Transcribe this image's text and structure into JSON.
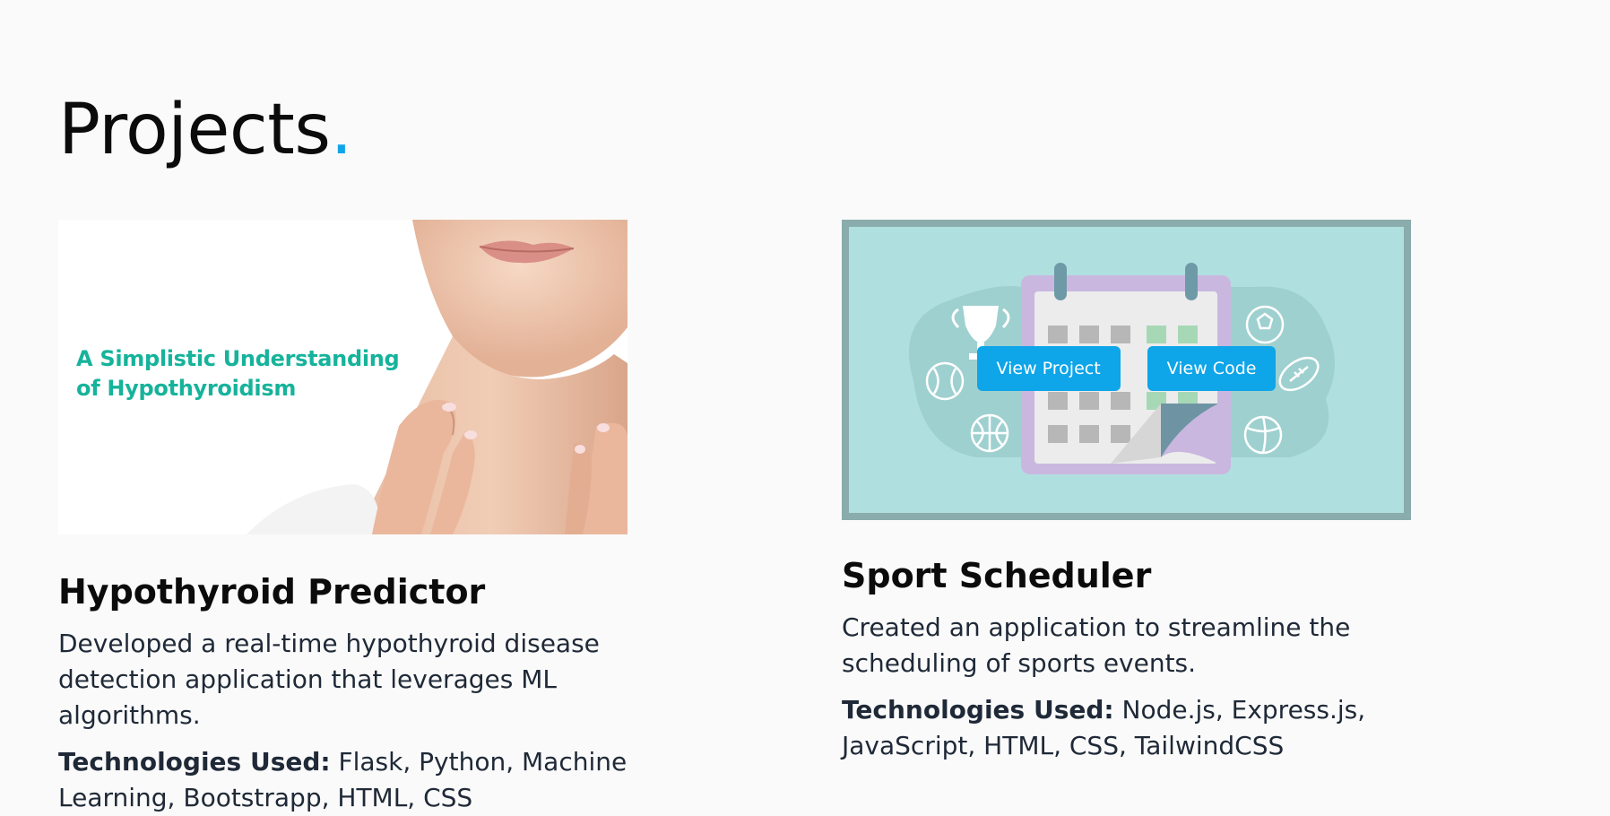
{
  "section": {
    "title": "Projects",
    "title_dot": "."
  },
  "projects": [
    {
      "image_caption_line1": "A Simplistic Understanding",
      "image_caption_line2": "of Hypothyroidism",
      "title": "Hypothyroid Predictor",
      "description": "Developed a real-time hypothyroid disease detection application that leverages ML algorithms.",
      "tech_label": "Technologies Used:",
      "tech_value": " Flask, Python, Machine Learning, Bootstrapp, HTML, CSS"
    },
    {
      "title": "Sport Scheduler",
      "description": "Created an application to streamline the scheduling of sports events.",
      "tech_label": "Technologies Used:",
      "tech_value": " Node.js, Express.js, JavaScript, HTML, CSS, TailwindCSS",
      "view_project_label": "View Project",
      "view_code_label": "View Code"
    }
  ],
  "icons": [
    "trophy-icon",
    "calendar-icon",
    "soccer-ball-icon",
    "football-icon",
    "baseball-icon",
    "basketball-icon",
    "volleyball-icon"
  ],
  "colors": {
    "accent": "#0ea5e9",
    "caption_green": "#16b39b",
    "calendar_bg": "#b0dfdf",
    "calendar_frame": "#8aacac"
  }
}
